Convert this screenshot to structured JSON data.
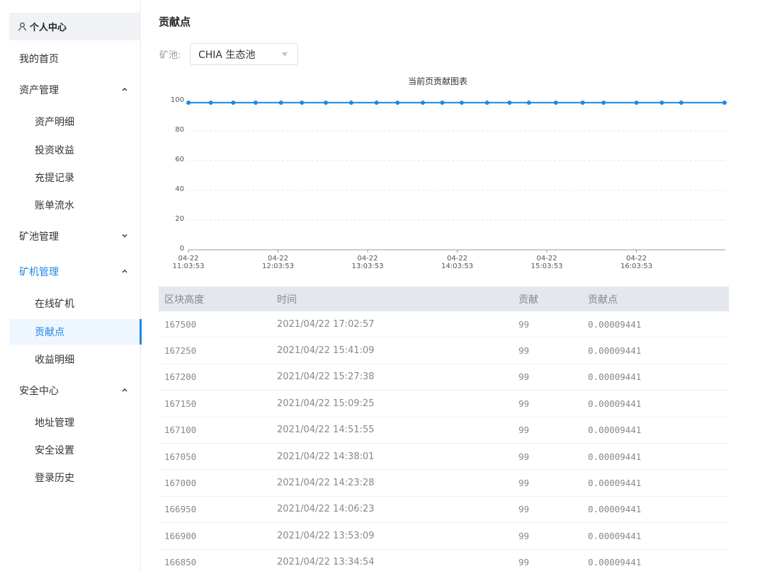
{
  "sidebar": {
    "header": "个人中心",
    "home": "我的首页",
    "asset_mgmt": {
      "label": "资产管理",
      "items": [
        "资产明细",
        "投资收益",
        "充提记录",
        "账单流水"
      ]
    },
    "pool_mgmt": {
      "label": "矿池管理"
    },
    "miner_mgmt": {
      "label": "矿机管理",
      "items": [
        "在线矿机",
        "贡献点",
        "收益明细"
      ]
    },
    "security": {
      "label": "安全中心",
      "items": [
        "地址管理",
        "安全设置",
        "登录历史"
      ]
    }
  },
  "main": {
    "title": "贡献点",
    "pool_label": "矿池:",
    "pool_value": "CHIA 生态池"
  },
  "chart_data": {
    "type": "line",
    "title": "当前页贡献图表",
    "ylim": [
      0,
      100
    ],
    "yticks": [
      "0",
      "20",
      "40",
      "60",
      "80",
      "100"
    ],
    "x_tick_labels": [
      "04-22 11:03:53",
      "04-22 12:03:53",
      "04-22 13:03:53",
      "04-22 14:03:53",
      "04-22 15:03:53",
      "04-22 16:03:53"
    ],
    "x_start": "04-22 11:03:53",
    "x_hours": 7.3,
    "x": [
      "11:03",
      "11:18",
      "11:33",
      "11:48",
      "12:05",
      "12:19",
      "12:35",
      "12:52",
      "13:09",
      "13:23",
      "13:40",
      "13:53",
      "14:06",
      "14:23",
      "14:38",
      "14:51",
      "15:09",
      "15:27",
      "15:41",
      "16:03",
      "16:20",
      "16:33",
      "17:02"
    ],
    "y": [
      99,
      99,
      99,
      99,
      99,
      99,
      99,
      99,
      99,
      99,
      99,
      99,
      99,
      99,
      99,
      99,
      99,
      99,
      99,
      99,
      99,
      99,
      99
    ],
    "color": "#1e88e5",
    "grid": true
  },
  "table": {
    "headers": [
      "区块高度",
      "时间",
      "贡献",
      "贡献点"
    ],
    "rows": [
      [
        "167500",
        "2021/04/22 17:02:57",
        "99",
        "0.00009441"
      ],
      [
        "167250",
        "2021/04/22 15:41:09",
        "99",
        "0.00009441"
      ],
      [
        "167200",
        "2021/04/22 15:27:38",
        "99",
        "0.00009441"
      ],
      [
        "167150",
        "2021/04/22 15:09:25",
        "99",
        "0.00009441"
      ],
      [
        "167100",
        "2021/04/22 14:51:55",
        "99",
        "0.00009441"
      ],
      [
        "167050",
        "2021/04/22 14:38:01",
        "99",
        "0.00009441"
      ],
      [
        "167000",
        "2021/04/22 14:23:28",
        "99",
        "0.00009441"
      ],
      [
        "166950",
        "2021/04/22 14:06:23",
        "99",
        "0.00009441"
      ],
      [
        "166900",
        "2021/04/22 13:53:09",
        "99",
        "0.00009441"
      ],
      [
        "166850",
        "2021/04/22 13:34:54",
        "99",
        "0.00009441"
      ]
    ]
  }
}
